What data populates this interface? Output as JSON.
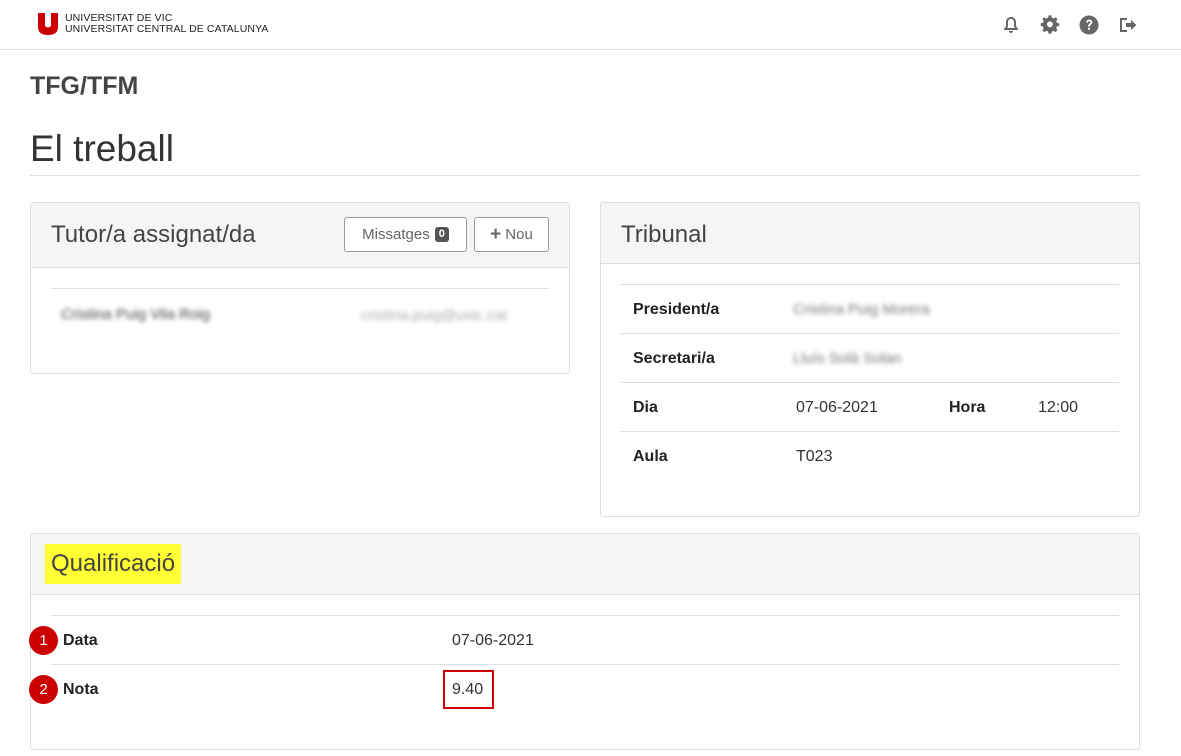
{
  "header": {
    "logo_line1": "UNIVERSITAT DE VIC",
    "logo_line2": "UNIVERSITAT CENTRAL DE CATALUNYA",
    "brand_color": "#cc0000",
    "icons": [
      "bell-icon",
      "gear-icon",
      "help-icon",
      "logout-icon"
    ]
  },
  "app_title": "TFG/TFM",
  "page_title": "El treball",
  "tutor": {
    "title": "Tutor/a assignat/da",
    "messages_label": "Missatges",
    "messages_count": "0",
    "new_label": "Nou",
    "name": "Cristina Puig Vila Roig",
    "email": "cristina.puig@uvic.cat"
  },
  "tribunal": {
    "title": "Tribunal",
    "president_label": "President/a",
    "president_value": "Cristina Puig Morera",
    "secretary_label": "Secretari/a",
    "secretary_value": "Lluís Solà Solan",
    "day_label": "Dia",
    "day_value": "07-06-2021",
    "hour_label": "Hora",
    "hour_value": "12:00",
    "room_label": "Aula",
    "room_value": "T023"
  },
  "qualification": {
    "title": "Qualificació",
    "highlight_color": "#ffff33",
    "marker_color": "#cc0000",
    "date_marker": "1",
    "date_label": "Data",
    "date_value": "07-06-2021",
    "grade_marker": "2",
    "grade_label": "Nota",
    "grade_value": "9.40"
  }
}
